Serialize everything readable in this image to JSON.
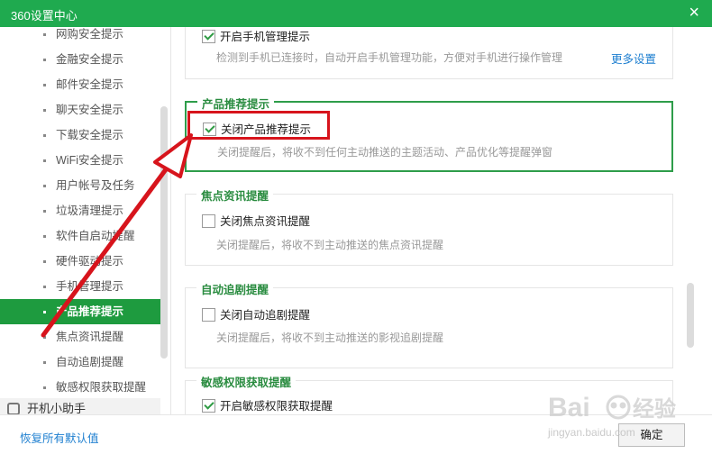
{
  "window": {
    "title": "360设置中心",
    "close_glyph": "×"
  },
  "sidebar": {
    "items": [
      {
        "label": "网购安全提示"
      },
      {
        "label": "金融安全提示"
      },
      {
        "label": "邮件安全提示"
      },
      {
        "label": "聊天安全提示"
      },
      {
        "label": "下载安全提示"
      },
      {
        "label": "WiFi安全提示"
      },
      {
        "label": "用户帐号及任务"
      },
      {
        "label": "垃圾清理提示"
      },
      {
        "label": "软件自启动提醒"
      },
      {
        "label": "硬件驱动提示"
      },
      {
        "label": "手机管理提示"
      },
      {
        "label": "产品推荐提示",
        "active": true
      },
      {
        "label": "焦点资讯提醒"
      },
      {
        "label": "自动追剧提醒"
      },
      {
        "label": "敏感权限获取提醒"
      }
    ],
    "group_label": "开机小助手"
  },
  "main": {
    "phone": {
      "option_label": "开启手机管理提示",
      "checked": true,
      "desc": "检测到手机已连接时，自动开启手机管理功能，方便对手机进行操作管理",
      "more_link": "更多设置"
    },
    "product": {
      "legend": "产品推荐提示",
      "option_label": "关闭产品推荐提示",
      "checked": true,
      "desc": "关闭提醒后，将收不到任何主动推送的主题活动、产品优化等提醒弹窗"
    },
    "focus": {
      "legend": "焦点资讯提醒",
      "option_label": "关闭焦点资讯提醒",
      "checked": false,
      "desc": "关闭提醒后，将收不到主动推送的焦点资讯提醒"
    },
    "drama": {
      "legend": "自动追剧提醒",
      "option_label": "关闭自动追剧提醒",
      "checked": false,
      "desc": "关闭提醒后，将收不到主动推送的影视追剧提醒"
    },
    "sensitive": {
      "legend": "敏感权限获取提醒",
      "option_label": "开启敏感权限获取提醒",
      "checked": true
    }
  },
  "footer": {
    "restore_label": "恢复所有默认值",
    "ok_label": "确定"
  },
  "watermark": {
    "brand": "Bai",
    "brand_cn": "经验",
    "url": "jingyan.baidu.com"
  },
  "colors": {
    "title_bar": "#1faa4f",
    "active_item": "#1e9b3f",
    "highlight_border": "#2e9d4a",
    "annotation_red": "#d7141c",
    "link": "#1e7fd0"
  }
}
